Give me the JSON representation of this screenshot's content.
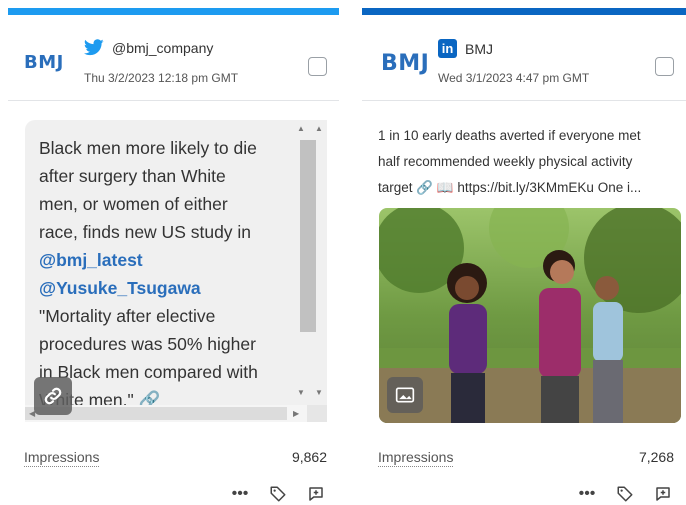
{
  "cards": [
    {
      "logo": "BMJ",
      "network": "twitter",
      "account": "@bmj_company",
      "date": "Thu 3/2/2023 12:18 pm GMT",
      "text_lines": [
        "Black men more likely to die",
        "after surgery than White",
        "men, or women of either",
        "race, finds new US study in"
      ],
      "mentions": [
        "@bmj_latest",
        "@Yusuke_Tsugawa"
      ],
      "text_lines2": [
        "\"Mortality after elective",
        "procedures was 50% higher",
        "in Black men compared with",
        "White men.\" 🔗"
      ],
      "metric_label": "Impressions",
      "metric_value": "9,862",
      "accent": "#1d9bf0"
    },
    {
      "logo": "BMJ",
      "network": "linkedin",
      "account": "BMJ",
      "date": "Wed 3/1/2023 4:47 pm GMT",
      "text_lines": [
        "1 in 10 early deaths averted if everyone met",
        "half recommended weekly physical activity",
        "target 🔗 📖 https://bit.ly/3KMmEKu One i..."
      ],
      "metric_label": "Impressions",
      "metric_value": "7,268",
      "accent": "#0a66c2"
    }
  ],
  "icons": {
    "more": "more-icon",
    "tag": "tag-icon",
    "reply": "reply-icon",
    "link": "link-icon",
    "image": "image-icon"
  }
}
